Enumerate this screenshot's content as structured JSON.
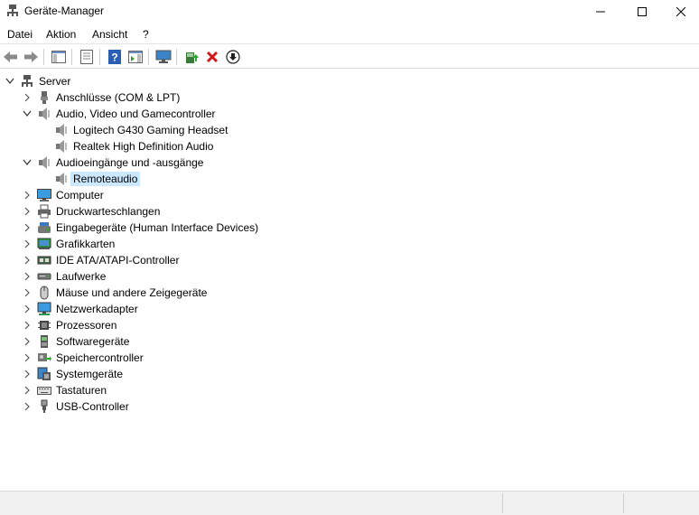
{
  "window": {
    "title": "Geräte-Manager",
    "app_icon": "device-manager-icon"
  },
  "menu": {
    "items": [
      {
        "label": "Datei"
      },
      {
        "label": "Aktion"
      },
      {
        "label": "Ansicht"
      },
      {
        "label": "?"
      }
    ]
  },
  "toolbar": {
    "buttons": [
      {
        "icon": "back-arrow-icon"
      },
      {
        "icon": "forward-arrow-icon"
      },
      {
        "icon": "show-hide-console-tree-icon"
      },
      {
        "icon": "properties-icon"
      },
      {
        "icon": "help-icon"
      },
      {
        "icon": "action-pane-icon"
      },
      {
        "icon": "monitor-scan-icon"
      },
      {
        "icon": "update-driver-icon"
      },
      {
        "icon": "uninstall-x-icon"
      },
      {
        "icon": "disable-down-arrow-icon"
      }
    ]
  },
  "tree": {
    "root": {
      "label": "Server",
      "expanded": true
    },
    "nodes": [
      {
        "label": "Anschlüsse (COM & LPT)",
        "icon": "port-icon",
        "expanded": false,
        "level": 1
      },
      {
        "label": "Audio, Video und Gamecontroller",
        "icon": "speaker-icon",
        "expanded": true,
        "level": 1
      },
      {
        "label": "Logitech G430 Gaming Headset",
        "icon": "speaker-icon",
        "level": 2
      },
      {
        "label": "Realtek High Definition Audio",
        "icon": "speaker-icon",
        "level": 2
      },
      {
        "label": "Audioeingänge und -ausgänge",
        "icon": "speaker-icon",
        "expanded": true,
        "level": 1
      },
      {
        "label": "Remoteaudio",
        "icon": "speaker-icon",
        "level": 2,
        "selected": true
      },
      {
        "label": "Computer",
        "icon": "computer-icon",
        "expanded": false,
        "level": 1
      },
      {
        "label": "Druckwarteschlangen",
        "icon": "printer-icon",
        "expanded": false,
        "level": 1
      },
      {
        "label": "Eingabegeräte (Human Interface Devices)",
        "icon": "hid-icon",
        "expanded": false,
        "level": 1
      },
      {
        "label": "Grafikkarten",
        "icon": "display-adapter-icon",
        "expanded": false,
        "level": 1
      },
      {
        "label": "IDE ATA/ATAPI-Controller",
        "icon": "ide-controller-icon",
        "expanded": false,
        "level": 1
      },
      {
        "label": "Laufwerke",
        "icon": "disk-drive-icon",
        "expanded": false,
        "level": 1
      },
      {
        "label": "Mäuse und andere Zeigegeräte",
        "icon": "mouse-icon",
        "expanded": false,
        "level": 1
      },
      {
        "label": "Netzwerkadapter",
        "icon": "network-adapter-icon",
        "expanded": false,
        "level": 1
      },
      {
        "label": "Prozessoren",
        "icon": "processor-icon",
        "expanded": false,
        "level": 1
      },
      {
        "label": "Softwaregeräte",
        "icon": "software-device-icon",
        "expanded": false,
        "level": 1
      },
      {
        "label": "Speichercontroller",
        "icon": "storage-controller-icon",
        "expanded": false,
        "level": 1
      },
      {
        "label": "Systemgeräte",
        "icon": "system-device-icon",
        "expanded": false,
        "level": 1
      },
      {
        "label": "Tastaturen",
        "icon": "keyboard-icon",
        "expanded": false,
        "level": 1
      },
      {
        "label": "USB-Controller",
        "icon": "usb-icon",
        "expanded": false,
        "level": 1
      }
    ]
  },
  "colors": {
    "selection": "#cce8ff",
    "statusbar": "#f0f0f0",
    "close_icon": "#d11a1a",
    "help_blue": "#2b5fb4"
  }
}
